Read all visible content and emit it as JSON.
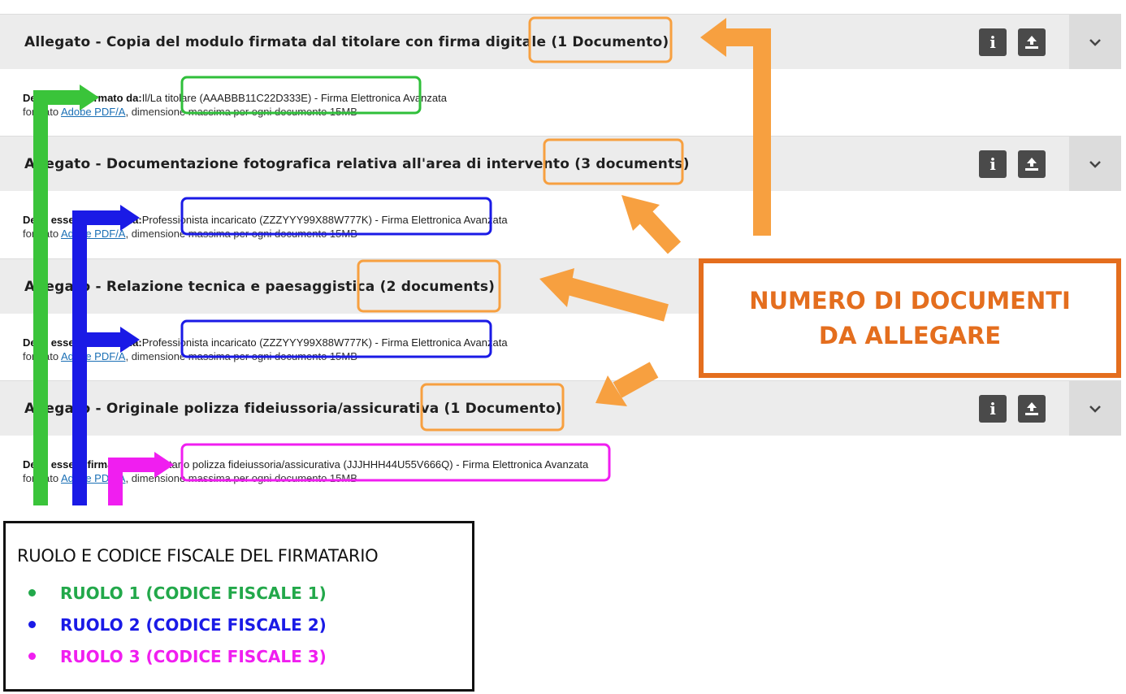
{
  "attachments": [
    {
      "title": "Allegato - Copia del modulo firmata dal titolare con firma digitale",
      "count": "(1 Documento)",
      "sign_label": "Deve essere firmato da:",
      "signer": "Il/La titolare  (AAABBB11C22D333E)",
      "sign_suffix": " - Firma Elettronica Avanzata",
      "format_prefix": "formato ",
      "format_link": "Adobe PDF/A",
      "format_suffix": ", dimensione massima per ogni documento 15MB",
      "signer_color": "#2fbf3a"
    },
    {
      "title": "Allegato - Documentazione fotografica relativa all'area di intervento",
      "count": "(3 documents)",
      "sign_label": "Deve essere firmato da:",
      "signer": "Professionista incaricato  (ZZZYYY99X88W777K)",
      "sign_suffix": " - Firma Elettronica Avanzata",
      "format_prefix": "formato ",
      "format_link": "Adobe PDF/A",
      "format_suffix": ", dimensione massima per ogni documento 15MB",
      "signer_color": "#1a1ae6"
    },
    {
      "title": "Allegato - Relazione tecnica e paesaggistica",
      "count": "(2 documents)",
      "sign_label": "Deve essere firmato da:",
      "signer": "Professionista incaricato  (ZZZYYY99X88W777K)",
      "sign_suffix": " - Firma Elettronica Avanzata",
      "format_prefix": "formato ",
      "format_link": "Adobe PDF/A",
      "format_suffix": ", dimensione massima per ogni documento 15MB",
      "signer_color": "#1a1ae6"
    },
    {
      "title": "Allegato - Originale polizza fideiussoria/assicurativa",
      "count": "(1 Documento)",
      "sign_label": "Deve essere firmato da:",
      "signer": "Firmatario polizza fideiussoria/assicurativa  (JJJHHH44U55V666Q)",
      "sign_suffix": " - Firma Elettronica Avanzata",
      "format_prefix": "formato ",
      "format_link": "Adobe PDF/A",
      "format_suffix": ", dimensione massima per ogni documento 15MB",
      "signer_color": "#f01ef0"
    }
  ],
  "header_buttons": {
    "info_icon": "info-icon",
    "upload_icon": "upload-icon",
    "expand_icon": "chevron-down-icon"
  },
  "callout": {
    "line1": "NUMERO DI DOCUMENTI",
    "line2": "DA ALLEGARE",
    "color": "#e46e1e"
  },
  "legend": {
    "title": "RUOLO E CODICE FISCALE DEL FIRMATARIO",
    "items": [
      {
        "text": "RUOLO 1 (CODICE FISCALE 1)",
        "color": "#22a84a"
      },
      {
        "text": "RUOLO 2 (CODICE FISCALE 2)",
        "color": "#1a1ae6"
      },
      {
        "text": "RUOLO 3 (CODICE FISCALE 3)",
        "color": "#f01ef0"
      }
    ]
  },
  "annotation_colors": {
    "count_box": "#f7a040",
    "arrow_orange": "#f7a040",
    "arrow_green": "#3ac43a",
    "arrow_blue": "#1a1ae6",
    "arrow_magenta": "#f01ef0"
  }
}
